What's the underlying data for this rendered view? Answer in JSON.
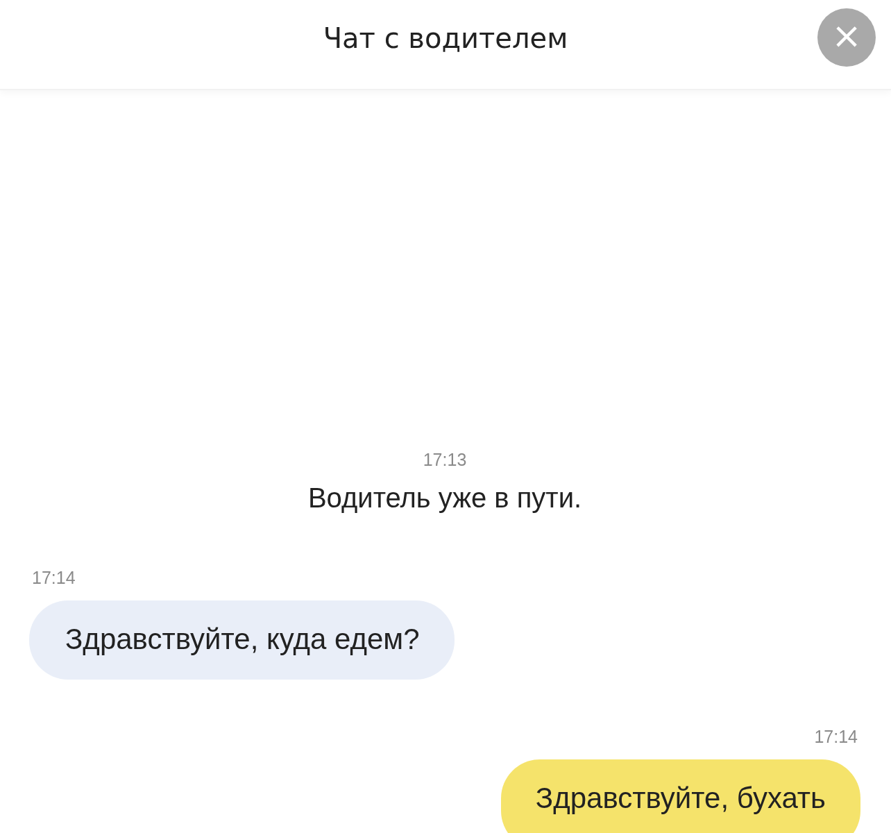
{
  "header": {
    "title": "Чат с водителем",
    "close": "×"
  },
  "messages": [
    {
      "kind": "system",
      "time": "17:13",
      "text": "Водитель уже в пути."
    },
    {
      "kind": "incoming",
      "time": "17:14",
      "text": "Здравствуйте, куда едем?"
    },
    {
      "kind": "outgoing",
      "time": "17:14",
      "text": "Здравствуйте, бухать"
    }
  ]
}
